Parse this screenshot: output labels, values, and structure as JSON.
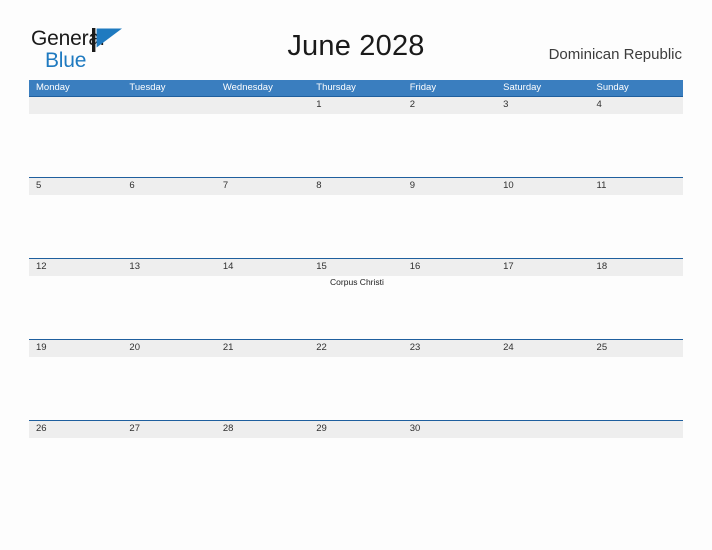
{
  "brand": {
    "name_line1": "General",
    "name_line2": "Blue",
    "flag_icon": "blue-triangle-flag-icon",
    "color_dark": "#1a1a1a",
    "color_blue": "#1f7ac0"
  },
  "header": {
    "title": "June 2028",
    "region": "Dominican Republic"
  },
  "theme": {
    "header_blue": "#3a7ebf",
    "band_gray": "#eeeeee",
    "band_border": "#1f5f9e",
    "page_background": "#fdfdfd",
    "text_dark": "#303030"
  },
  "weekdays": [
    "Monday",
    "Tuesday",
    "Wednesday",
    "Thursday",
    "Friday",
    "Saturday",
    "Sunday"
  ],
  "weeks": [
    [
      {
        "date": "",
        "events": []
      },
      {
        "date": "",
        "events": []
      },
      {
        "date": "",
        "events": []
      },
      {
        "date": "1",
        "events": []
      },
      {
        "date": "2",
        "events": []
      },
      {
        "date": "3",
        "events": []
      },
      {
        "date": "4",
        "events": []
      }
    ],
    [
      {
        "date": "5",
        "events": []
      },
      {
        "date": "6",
        "events": []
      },
      {
        "date": "7",
        "events": []
      },
      {
        "date": "8",
        "events": []
      },
      {
        "date": "9",
        "events": []
      },
      {
        "date": "10",
        "events": []
      },
      {
        "date": "11",
        "events": []
      }
    ],
    [
      {
        "date": "12",
        "events": []
      },
      {
        "date": "13",
        "events": []
      },
      {
        "date": "14",
        "events": []
      },
      {
        "date": "15",
        "events": [
          "Corpus Christi"
        ]
      },
      {
        "date": "16",
        "events": []
      },
      {
        "date": "17",
        "events": []
      },
      {
        "date": "18",
        "events": []
      }
    ],
    [
      {
        "date": "19",
        "events": []
      },
      {
        "date": "20",
        "events": []
      },
      {
        "date": "21",
        "events": []
      },
      {
        "date": "22",
        "events": []
      },
      {
        "date": "23",
        "events": []
      },
      {
        "date": "24",
        "events": []
      },
      {
        "date": "25",
        "events": []
      }
    ],
    [
      {
        "date": "26",
        "events": []
      },
      {
        "date": "27",
        "events": []
      },
      {
        "date": "28",
        "events": []
      },
      {
        "date": "29",
        "events": []
      },
      {
        "date": "30",
        "events": []
      },
      {
        "date": "",
        "events": []
      },
      {
        "date": "",
        "events": []
      }
    ]
  ]
}
